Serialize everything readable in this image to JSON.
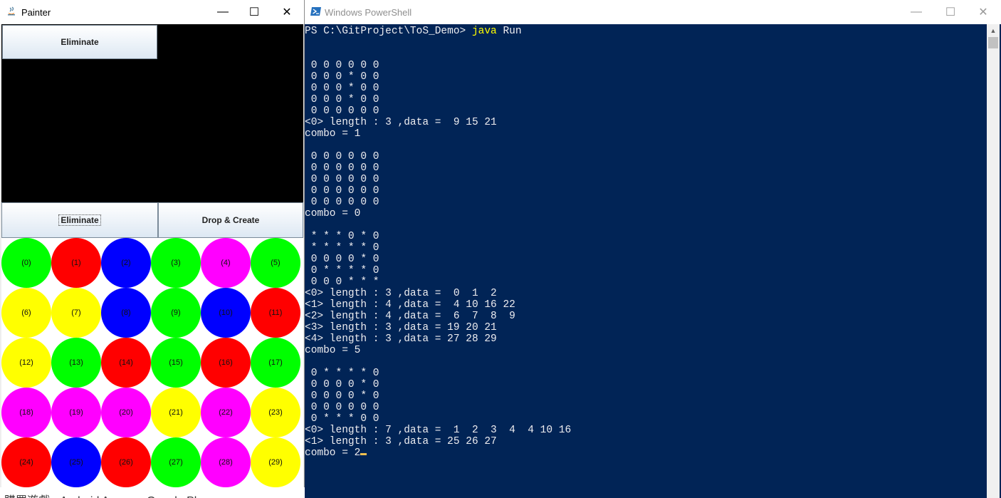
{
  "painter": {
    "title": "Painter",
    "top_button": "Eliminate",
    "eliminate_button": "Eliminate",
    "drop_create_button": "Drop & Create",
    "colors": {
      "green": "#00ff00",
      "red": "#ff0000",
      "blue": "#0000ff",
      "magenta": "#ff00ff",
      "yellow": "#ffff00"
    },
    "balls": [
      {
        "label": "(0)",
        "color": "green"
      },
      {
        "label": "(1)",
        "color": "red"
      },
      {
        "label": "(2)",
        "color": "blue"
      },
      {
        "label": "(3)",
        "color": "green"
      },
      {
        "label": "(4)",
        "color": "magenta"
      },
      {
        "label": "(5)",
        "color": "green"
      },
      {
        "label": "(6)",
        "color": "yellow"
      },
      {
        "label": "(7)",
        "color": "yellow"
      },
      {
        "label": "(8)",
        "color": "blue"
      },
      {
        "label": "(9)",
        "color": "green"
      },
      {
        "label": "(10)",
        "color": "blue"
      },
      {
        "label": "(11)",
        "color": "red"
      },
      {
        "label": "(12)",
        "color": "yellow"
      },
      {
        "label": "(13)",
        "color": "green"
      },
      {
        "label": "(14)",
        "color": "red"
      },
      {
        "label": "(15)",
        "color": "green"
      },
      {
        "label": "(16)",
        "color": "red"
      },
      {
        "label": "(17)",
        "color": "green"
      },
      {
        "label": "(18)",
        "color": "magenta"
      },
      {
        "label": "(19)",
        "color": "magenta"
      },
      {
        "label": "(20)",
        "color": "magenta"
      },
      {
        "label": "(21)",
        "color": "yellow"
      },
      {
        "label": "(22)",
        "color": "magenta"
      },
      {
        "label": "(23)",
        "color": "yellow"
      },
      {
        "label": "(24)",
        "color": "red"
      },
      {
        "label": "(25)",
        "color": "blue"
      },
      {
        "label": "(26)",
        "color": "red"
      },
      {
        "label": "(27)",
        "color": "green"
      },
      {
        "label": "(28)",
        "color": "magenta"
      },
      {
        "label": "(29)",
        "color": "yellow"
      }
    ],
    "background_text": "購買遊戲 - Android Apps on Google Play"
  },
  "powershell": {
    "title": "Windows PowerShell",
    "prompt": "PS C:\\GitProject\\ToS_Demo> ",
    "command_keyword": "java",
    "command_args": " Run",
    "output": "\n\n 0 0 0 0 0 0\n 0 0 0 * 0 0\n 0 0 0 * 0 0\n 0 0 0 * 0 0\n 0 0 0 0 0 0\n<0> length : 3 ,data =  9 15 21\ncombo = 1\n\n 0 0 0 0 0 0\n 0 0 0 0 0 0\n 0 0 0 0 0 0\n 0 0 0 0 0 0\n 0 0 0 0 0 0\ncombo = 0\n\n * * * 0 * 0\n * * * * * 0\n 0 0 0 0 * 0\n 0 * * * * 0\n 0 0 0 * * *\n<0> length : 3 ,data =  0  1  2\n<1> length : 4 ,data =  4 10 16 22\n<2> length : 4 ,data =  6  7  8  9\n<3> length : 3 ,data = 19 20 21\n<4> length : 3 ,data = 27 28 29\ncombo = 5\n\n 0 * * * * 0\n 0 0 0 0 * 0\n 0 0 0 0 * 0\n 0 0 0 0 0 0\n 0 * * * 0 0\n<0> length : 7 ,data =  1  2  3  4  4 10 16\n<1> length : 3 ,data = 25 26 27\ncombo = 2"
  },
  "window_controls": {
    "minimize": "—",
    "maximize": "☐",
    "close": "✕"
  }
}
